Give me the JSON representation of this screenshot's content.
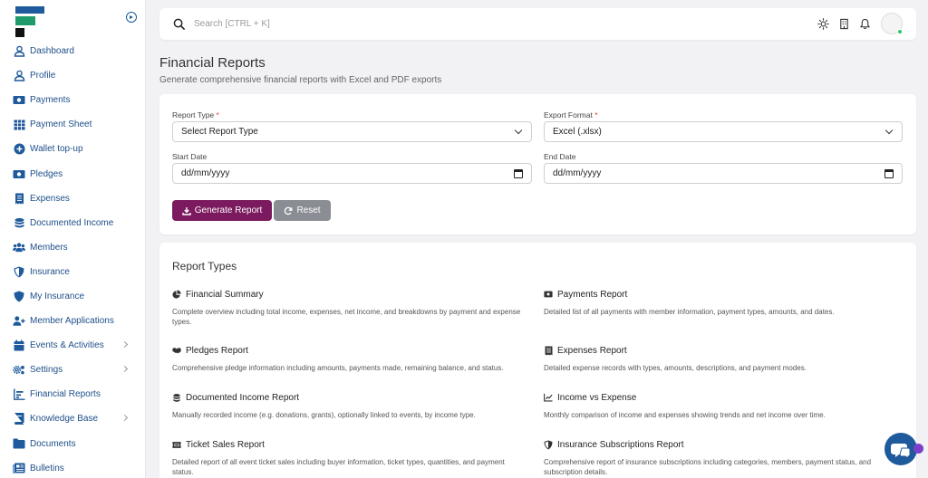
{
  "app": {
    "colors": {
      "primary": "#1e5a9c",
      "accent": "#7b1a5e",
      "logo_green": "#1f9a6b",
      "required": "#e53935"
    }
  },
  "sidebar": {
    "items": [
      {
        "label": "Dashboard",
        "icon": "user-icon",
        "chevron": false
      },
      {
        "label": "Profile",
        "icon": "user-icon",
        "chevron": false
      },
      {
        "label": "Payments",
        "icon": "money-bill-icon",
        "chevron": false
      },
      {
        "label": "Payment Sheet",
        "icon": "table-icon",
        "chevron": false
      },
      {
        "label": "Wallet top-up",
        "icon": "plus-circle-icon",
        "chevron": false
      },
      {
        "label": "Pledges",
        "icon": "money-bill-icon",
        "chevron": false
      },
      {
        "label": "Expenses",
        "icon": "receipt-icon",
        "chevron": false
      },
      {
        "label": "Documented Income",
        "icon": "coins-icon",
        "chevron": false
      },
      {
        "label": "Members",
        "icon": "users-icon",
        "chevron": false
      },
      {
        "label": "Insurance",
        "icon": "shield-icon",
        "chevron": false
      },
      {
        "label": "My Insurance",
        "icon": "shield-icon",
        "chevron": false
      },
      {
        "label": "Member Applications",
        "icon": "user-plus-icon",
        "chevron": false
      },
      {
        "label": "Events & Activities",
        "icon": "calendar-icon",
        "chevron": true
      },
      {
        "label": "Settings",
        "icon": "gears-icon",
        "chevron": true
      },
      {
        "label": "Financial Reports",
        "icon": "chart-bar-icon",
        "chevron": false
      },
      {
        "label": "Knowledge Base",
        "icon": "book-icon",
        "chevron": true
      },
      {
        "label": "Documents",
        "icon": "folder-icon",
        "chevron": false
      },
      {
        "label": "Bulletins",
        "icon": "newspaper-icon",
        "chevron": false
      }
    ]
  },
  "topbar": {
    "search_placeholder": "Search [CTRL + K]"
  },
  "page": {
    "title": "Financial Reports",
    "subtitle": "Generate comprehensive financial reports with Excel and PDF exports"
  },
  "form": {
    "report_type_label": "Report Type",
    "report_type_value": "Select Report Type",
    "export_format_label": "Export Format",
    "export_format_value": "Excel (.xlsx)",
    "start_date_label": "Start Date",
    "start_date_value": "dd/mm/yyyy",
    "end_date_label": "End Date",
    "end_date_value": "dd/mm/yyyy",
    "required_mark": "*",
    "generate_label": "Generate Report",
    "reset_label": "Reset"
  },
  "report_types": {
    "heading": "Report Types",
    "items": [
      {
        "title": "Financial Summary",
        "icon": "chart-pie-icon",
        "desc": "Complete overview including total income, expenses, net income, and breakdowns by payment and expense types."
      },
      {
        "title": "Payments Report",
        "icon": "money-bill-icon",
        "desc": "Detailed list of all payments with member information, payment types, amounts, and dates."
      },
      {
        "title": "Pledges Report",
        "icon": "handshake-icon",
        "desc": "Comprehensive pledge information including amounts, payments made, remaining balance, and status."
      },
      {
        "title": "Expenses Report",
        "icon": "receipt-icon",
        "desc": "Detailed expense records with types, amounts, descriptions, and payment modes."
      },
      {
        "title": "Documented Income Report",
        "icon": "coins-icon",
        "desc": "Manually recorded income (e.g. donations, grants), optionally linked to events, by income type."
      },
      {
        "title": "Income vs Expense",
        "icon": "chart-line-icon",
        "desc": "Monthly comparison of income and expenses showing trends and net income over time."
      },
      {
        "title": "Ticket Sales Report",
        "icon": "ticket-icon",
        "desc": "Detailed report of all event ticket sales including buyer information, ticket types, quantities, and payment status."
      },
      {
        "title": "Insurance Subscriptions Report",
        "icon": "shield-icon",
        "desc": "Comprehensive report of insurance subscriptions including categories, members, payment status, and subscription details."
      }
    ]
  }
}
